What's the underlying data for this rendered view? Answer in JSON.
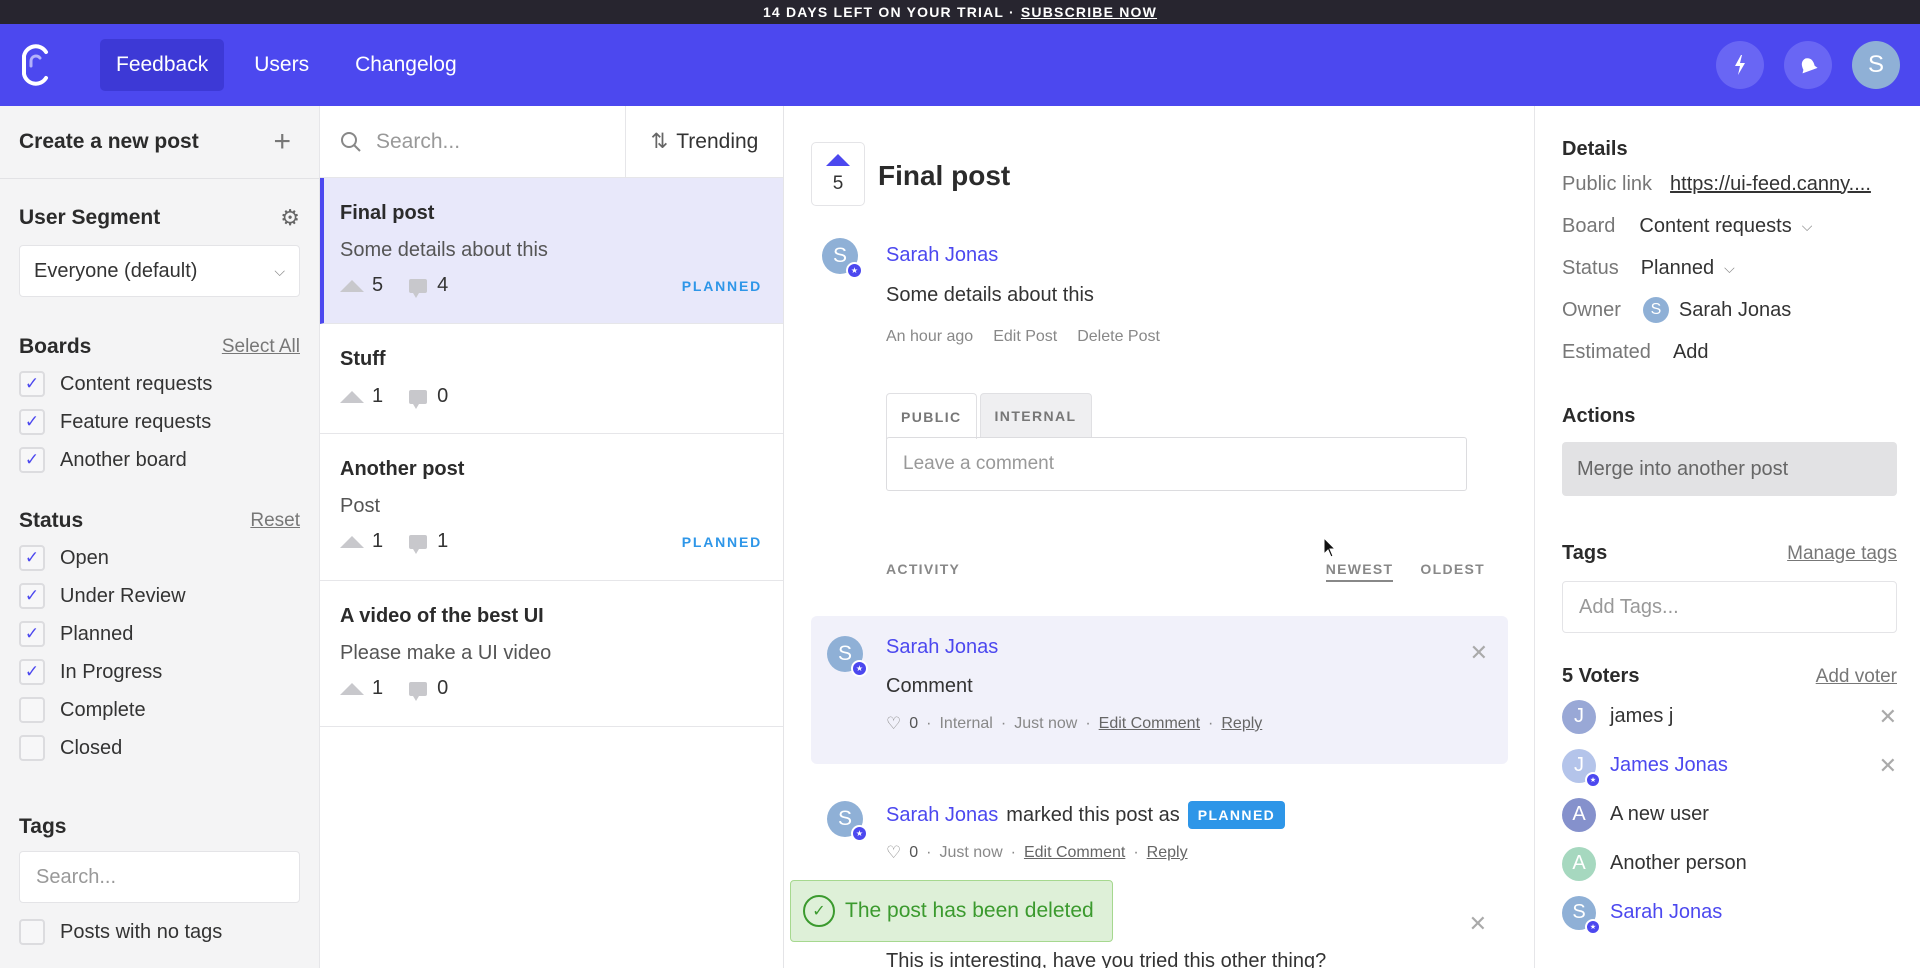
{
  "trial": {
    "text": "14 DAYS LEFT ON YOUR TRIAL ·",
    "cta": "SUBSCRIBE NOW"
  },
  "nav": {
    "logo": "canny-logo-icon",
    "tabs": [
      {
        "label": "Feedback",
        "active": true
      },
      {
        "label": "Users",
        "active": false
      },
      {
        "label": "Changelog",
        "active": false
      }
    ],
    "icons": [
      "lightning-icon",
      "bell-icon"
    ],
    "avatar_initial": "S"
  },
  "sidebar": {
    "create_label": "Create a new post",
    "segment": {
      "title": "User Segment",
      "value": "Everyone (default)"
    },
    "boards": {
      "title": "Boards",
      "action": "Select All",
      "items": [
        {
          "label": "Content requests",
          "checked": true
        },
        {
          "label": "Feature requests",
          "checked": true
        },
        {
          "label": "Another board",
          "checked": true
        }
      ]
    },
    "status": {
      "title": "Status",
      "action": "Reset",
      "items": [
        {
          "label": "Open",
          "checked": true
        },
        {
          "label": "Under Review",
          "checked": true
        },
        {
          "label": "Planned",
          "checked": true
        },
        {
          "label": "In Progress",
          "checked": true
        },
        {
          "label": "Complete",
          "checked": false
        },
        {
          "label": "Closed",
          "checked": false
        }
      ]
    },
    "tags": {
      "title": "Tags",
      "placeholder": "Search...",
      "no_tags_label": "Posts with no tags",
      "no_tags_checked": false
    }
  },
  "postlist": {
    "search_placeholder": "Search...",
    "sort_label": "Trending",
    "posts": [
      {
        "title": "Final post",
        "details": "Some details about this",
        "votes": "5",
        "comments": "4",
        "status": "PLANNED",
        "active": true
      },
      {
        "title": "Stuff",
        "details": "",
        "votes": "1",
        "comments": "0",
        "status": "",
        "active": false
      },
      {
        "title": "Another post",
        "details": "Post",
        "votes": "1",
        "comments": "1",
        "status": "PLANNED",
        "active": false
      },
      {
        "title": "A video of the best UI",
        "details": "Please make a UI video",
        "votes": "1",
        "comments": "0",
        "status": "",
        "active": false
      }
    ]
  },
  "detail": {
    "votes": "5",
    "title": "Final post",
    "author": "Sarah Jonas",
    "author_initial": "S",
    "body": "Some details about this",
    "time": "An hour ago",
    "edit": "Edit Post",
    "delete": "Delete Post",
    "tabs": {
      "public": "PUBLIC",
      "internal": "INTERNAL"
    },
    "comment_placeholder": "Leave a comment",
    "activity": {
      "title": "ACTIVITY",
      "newest": "NEWEST",
      "oldest": "OLDEST"
    },
    "comments": [
      {
        "author": "Sarah Jonas",
        "text": "Comment",
        "likes": "0",
        "visibility": "Internal",
        "time": "Just now",
        "edit": "Edit Comment",
        "reply": "Reply"
      },
      {
        "author": "Sarah Jonas",
        "action_text": "marked this post as",
        "badge": "PLANNED",
        "likes": "0",
        "time": "Just now",
        "edit": "Edit Comment",
        "reply": "Reply"
      },
      {
        "text": "This is interesting, have you tried this other thing?"
      }
    ],
    "toast": "The post has been deleted"
  },
  "right": {
    "details_title": "Details",
    "public_link_label": "Public link",
    "public_link": "https://ui-feed.canny....",
    "board_label": "Board",
    "board_value": "Content requests",
    "status_label": "Status",
    "status_value": "Planned",
    "owner_label": "Owner",
    "owner_value": "Sarah Jonas",
    "owner_initial": "S",
    "estimated_label": "Estimated",
    "estimated_value": "Add",
    "actions_title": "Actions",
    "merge_label": "Merge into another post",
    "tags_title": "Tags",
    "manage_tags": "Manage tags",
    "tags_placeholder": "Add Tags...",
    "voters_title": "5 Voters",
    "add_voter": "Add voter",
    "voters": [
      {
        "name": "james j",
        "initial": "J",
        "color": "#99a8d6",
        "admin": false,
        "removable": true
      },
      {
        "name": "James Jonas",
        "initial": "J",
        "color": "#b4c4ea",
        "admin": true,
        "removable": true
      },
      {
        "name": "A new user",
        "initial": "A",
        "color": "#8591cc",
        "admin": false,
        "removable": false
      },
      {
        "name": "Another person",
        "initial": "A",
        "color": "#a6d8bf",
        "admin": false,
        "removable": false
      },
      {
        "name": "Sarah Jonas",
        "initial": "S",
        "color": "#8fb0d6",
        "admin": true,
        "removable": false
      }
    ]
  },
  "colors": {
    "brand": "#4c48ef",
    "planned": "#2e96e8",
    "success": "#3b9a2e"
  }
}
